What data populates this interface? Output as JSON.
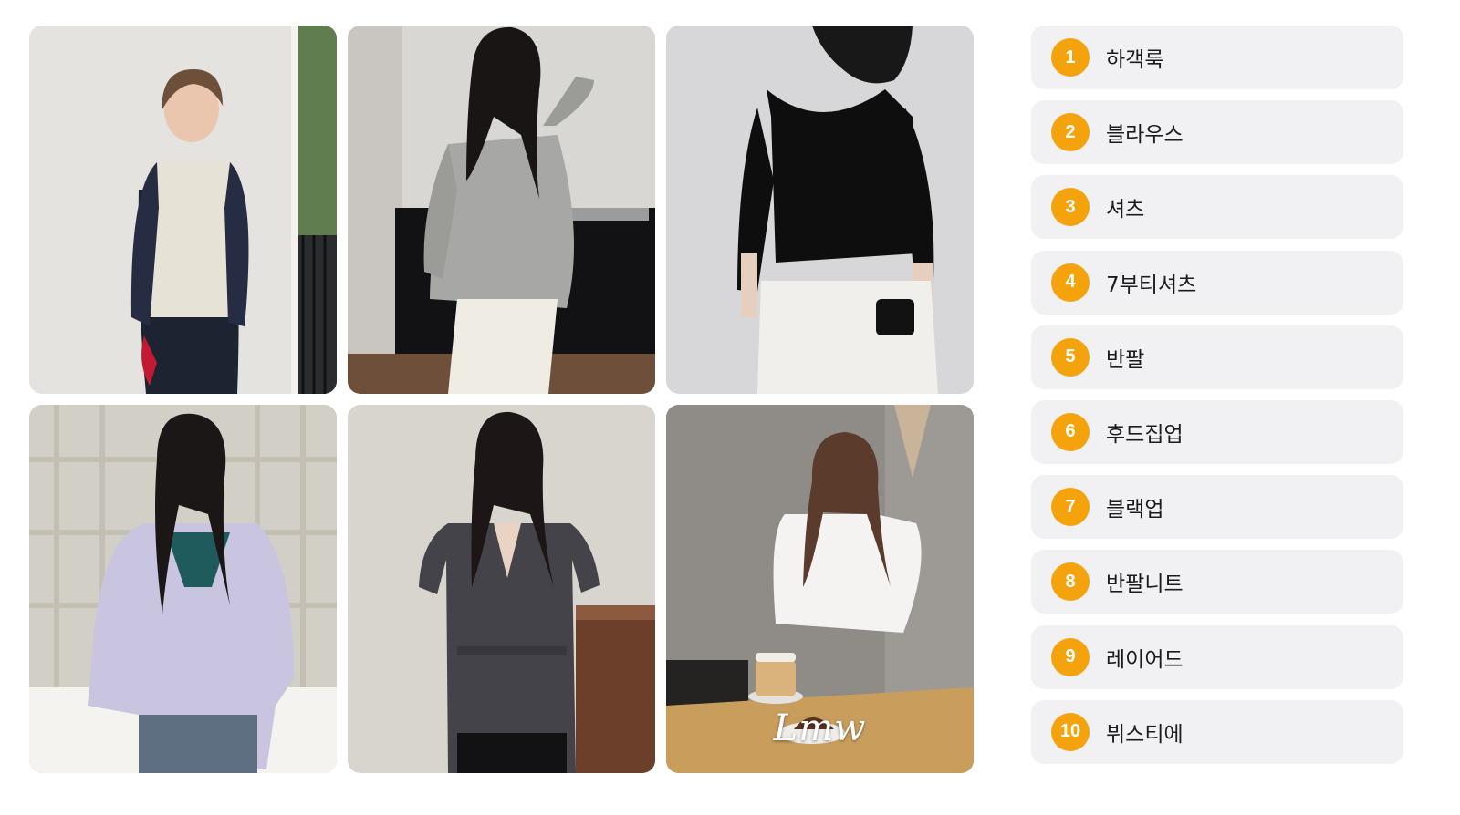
{
  "colors": {
    "badge": "#f5a30c",
    "item_background": "#f1f1f4",
    "text": "#1c1c1e"
  },
  "gallery": {
    "watermark": "Lmw",
    "photos": [
      {
        "name": "photo-raglan-tee"
      },
      {
        "name": "photo-striped-blouse"
      },
      {
        "name": "photo-black-tee"
      },
      {
        "name": "photo-lavender-knit"
      },
      {
        "name": "photo-charcoal-shirt"
      },
      {
        "name": "photo-white-blouse-cafe"
      }
    ]
  },
  "ranking": {
    "items": [
      {
        "rank": "1",
        "label": "하객룩"
      },
      {
        "rank": "2",
        "label": "블라우스"
      },
      {
        "rank": "3",
        "label": "셔츠"
      },
      {
        "rank": "4",
        "label": "7부티셔츠"
      },
      {
        "rank": "5",
        "label": "반팔"
      },
      {
        "rank": "6",
        "label": "후드집업"
      },
      {
        "rank": "7",
        "label": "블랙업"
      },
      {
        "rank": "8",
        "label": "반팔니트"
      },
      {
        "rank": "9",
        "label": "레이어드"
      },
      {
        "rank": "10",
        "label": "뷔스티에"
      }
    ]
  }
}
